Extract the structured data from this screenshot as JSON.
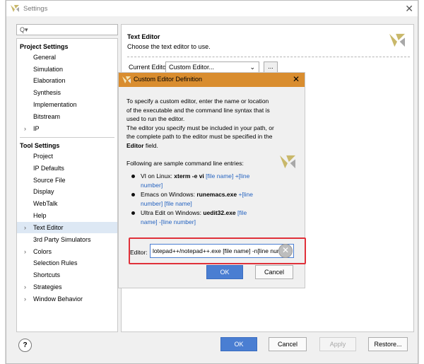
{
  "window": {
    "title": "Settings"
  },
  "search": {
    "placeholder": ""
  },
  "sidebar": {
    "project_settings": {
      "label": "Project Settings",
      "items": [
        {
          "label": "General"
        },
        {
          "label": "Simulation"
        },
        {
          "label": "Elaboration"
        },
        {
          "label": "Synthesis"
        },
        {
          "label": "Implementation"
        },
        {
          "label": "Bitstream"
        },
        {
          "label": "IP",
          "expandable": true
        }
      ]
    },
    "tool_settings": {
      "label": "Tool Settings",
      "items": [
        {
          "label": "Project"
        },
        {
          "label": "IP Defaults"
        },
        {
          "label": "Source File"
        },
        {
          "label": "Display"
        },
        {
          "label": "WebTalk"
        },
        {
          "label": "Help"
        },
        {
          "label": "Text Editor",
          "expandable": true,
          "selected": true
        },
        {
          "label": "3rd Party Simulators"
        },
        {
          "label": "Colors",
          "expandable": true
        },
        {
          "label": "Selection Rules"
        },
        {
          "label": "Shortcuts"
        },
        {
          "label": "Strategies",
          "expandable": true
        },
        {
          "label": "Window Behavior",
          "expandable": true
        }
      ]
    }
  },
  "panel": {
    "title": "Text Editor",
    "subtitle": "Choose the text editor to use.",
    "current_editor_label": "Current Editor:",
    "current_editor_value": "Custom Editor...",
    "browse_label": "..."
  },
  "dialog": {
    "title": "Custom Editor Definition",
    "intro_lines": [
      "To specify a custom editor, enter the name or location",
      "of the executable and the command line syntax that is",
      "used to run the editor.",
      "The editor you specify must be included in your path, or",
      "the complete path to the editor must be specified in the"
    ],
    "intro_last_bold": "Editor",
    "intro_last_rest": " field.",
    "sample_heading": "Following are sample command line entries:",
    "samples": [
      {
        "prefix": "VI on Linux: ",
        "cmd": "xterm -e vi",
        "args1": " [file name] +[line",
        "args2": "number]"
      },
      {
        "prefix": "Emacs on Windows: ",
        "cmd": "runemacs.exe",
        "args1": " +[line",
        "args2": "number] [file name]"
      },
      {
        "prefix": "Ultra Edit on Windows: ",
        "cmd": "uedit32.exe",
        "args1": " [file",
        "args2": "name] -[line number]"
      }
    ],
    "editor_label": "Editor:",
    "editor_value": "lotepad++/notepad++.exe [file name] -n[line num",
    "ok_label": "OK",
    "cancel_label": "Cancel"
  },
  "footer": {
    "help_label": "?",
    "ok_label": "OK",
    "cancel_label": "Cancel",
    "apply_label": "Apply",
    "restore_label": "Restore..."
  },
  "colors": {
    "accent": "#4a7ed2",
    "dialog_header": "#d98d2f",
    "highlight": "#e0313a"
  }
}
